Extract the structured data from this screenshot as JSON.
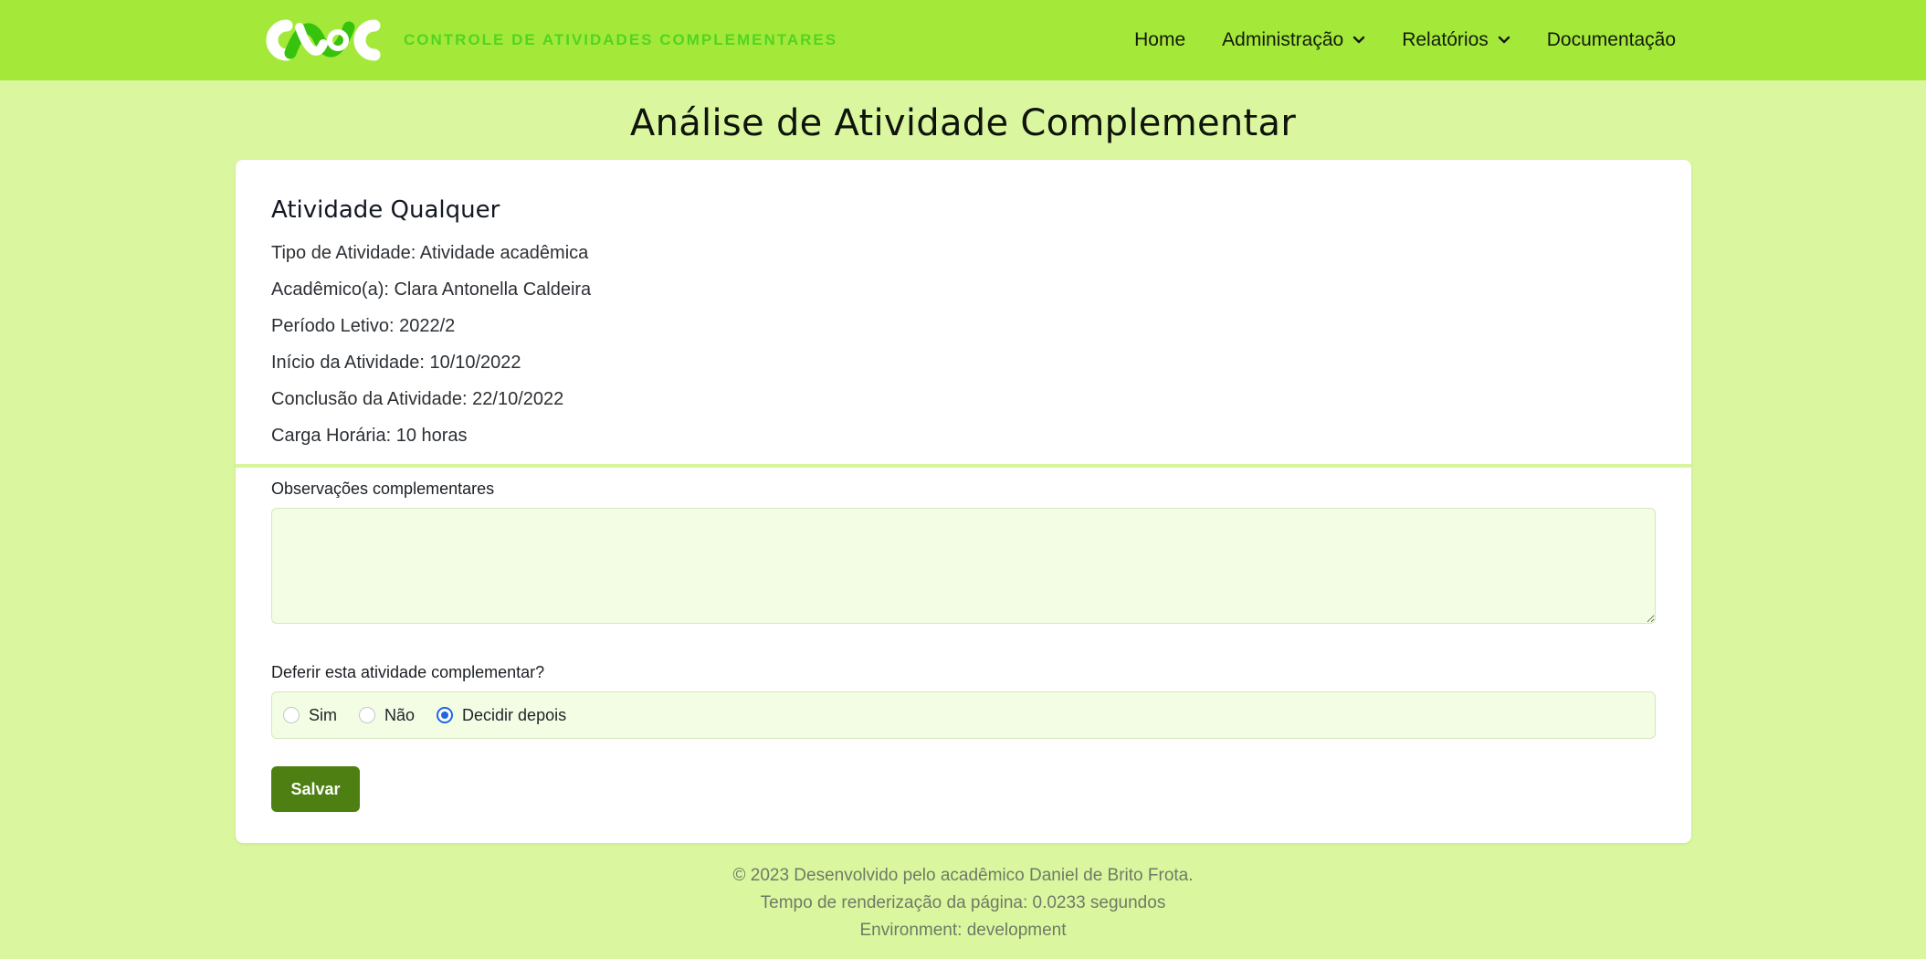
{
  "header": {
    "brand_text": "CONTROLE DE ATIVIDADES COMPLEMENTARES",
    "nav": [
      {
        "label": "Home"
      },
      {
        "label": "Administração"
      },
      {
        "label": "Relatórios"
      },
      {
        "label": "Documentação"
      }
    ]
  },
  "page": {
    "title": "Análise de Atividade Complementar"
  },
  "activity": {
    "name": "Atividade Qualquer",
    "tipo": "Tipo de Atividade: Atividade acadêmica",
    "academico": "Acadêmico(a): Clara Antonella Caldeira",
    "periodo": "Período Letivo: 2022/2",
    "inicio": "Início da Atividade: 10/10/2022",
    "conclusao": "Conclusão da Atividade: 22/10/2022",
    "carga": "Carga Horária: 10 horas"
  },
  "form": {
    "observacoes_label": "Observações complementares",
    "observacoes_value": "",
    "deferir_label": "Deferir esta atividade complementar?",
    "options": [
      {
        "label": "Sim",
        "checked": false
      },
      {
        "label": "Não",
        "checked": false
      },
      {
        "label": "Decidir depois",
        "checked": true
      }
    ],
    "save_label": "Salvar"
  },
  "footer": {
    "line1": "© 2023 Desenvolvido pelo acadêmico Daniel de Brito Frota.",
    "line2": "Tempo de renderização da página: 0.0233 segundos",
    "line3": "Environment: development"
  },
  "colors": {
    "navbar": "#a4e93a",
    "page_bg": "#daf79f",
    "primary_button": "#4e7f13",
    "brand_text": "#52d421",
    "radio_checked": "#2266e0"
  },
  "icons": {
    "logo": "cac-logo",
    "dropdown": "chevron-down-icon"
  }
}
